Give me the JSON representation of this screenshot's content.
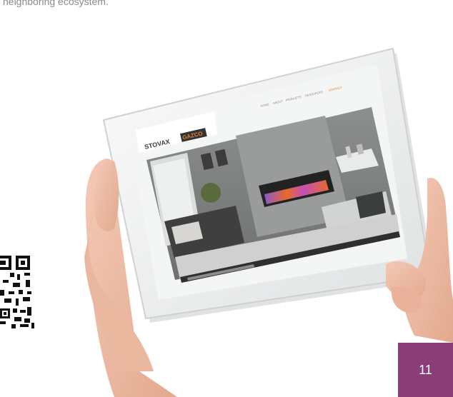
{
  "top_caption": "neighboring ecosystem.",
  "page_number": "11",
  "tablet": {
    "brand_left": "STOVAX",
    "brand_right": "GAZCO",
    "nav_items": [
      "HOME",
      "ABOUT",
      "PRODUCTS",
      "RESOURCES",
      "CONTACT"
    ]
  },
  "colors": {
    "badge": "#8b3d78",
    "tablet_frame": "#f1f2f2",
    "wall": "#7c7f80",
    "flame_orange": "#e86a2a",
    "flame_purple": "#8c57c9"
  }
}
